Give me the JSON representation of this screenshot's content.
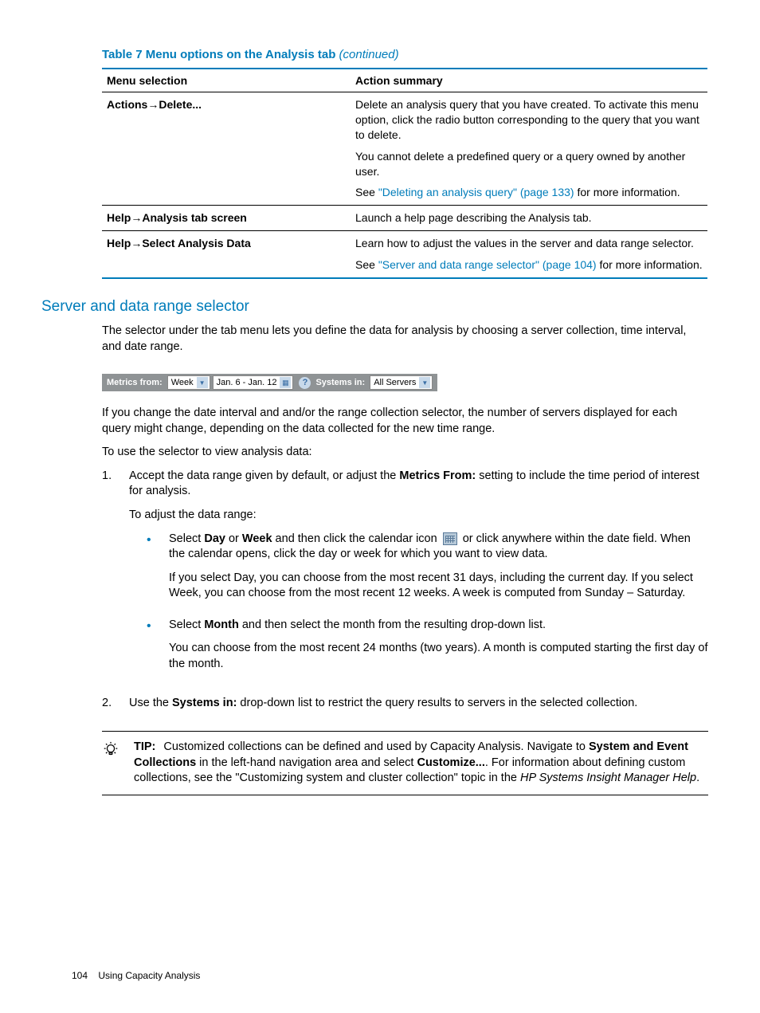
{
  "table": {
    "caption_main": "Table 7 Menu options on the Analysis tab ",
    "caption_cont": "(continued)",
    "headers": {
      "col1": "Menu selection",
      "col2": "Action summary"
    },
    "rows": [
      {
        "menu": "Actions→Delete...",
        "p1": "Delete an analysis query that you have created. To activate this menu option, click the radio button corresponding to the query that you want to delete.",
        "p2": "You cannot delete a predefined query or a query owned by another user.",
        "p3a": "See ",
        "p3link": "\"Deleting an analysis query\" (page 133)",
        "p3b": " for more information."
      },
      {
        "menu": "Help→Analysis tab screen",
        "p1": "Launch a help page describing the Analysis tab."
      },
      {
        "menu": "Help→Select Analysis Data",
        "p1": "Learn how to adjust the values in the server and data range selector.",
        "p2a": "See ",
        "p2link": "\"Server and data range selector\" (page 104)",
        "p2b": " for more information."
      }
    ]
  },
  "section_heading": "Server and data range selector",
  "intro": "The selector under the tab menu lets you define the data for analysis by choosing a server collection, time interval, and date range.",
  "toolbar": {
    "metrics_label": "Metrics from:",
    "week": "Week",
    "date": "Jan. 6 - Jan. 12",
    "help": "?",
    "systems_label": "Systems in:",
    "all": "All Servers"
  },
  "after_toolbar": "If you change the date interval and and/or the range collection selector, the number of servers displayed for each query might change, depending on the data collected for the new time range.",
  "lead": "To use the selector to view analysis data:",
  "step1": {
    "num": "1.",
    "p1a": "Accept the data range given by default, or adjust the ",
    "p1b": "Metrics From:",
    "p1c": " setting to include the time period of interest for analysis.",
    "p2": "To adjust the data range:"
  },
  "b1": {
    "p1a": "Select ",
    "p1b": "Day",
    "p1c": " or ",
    "p1d": "Week",
    "p1e": " and then click the calendar icon ",
    "p1f": " or click anywhere within the date field. When the calendar opens, click the day or week for which you want to view data.",
    "p2": "If you select Day, you can choose from the most recent 31 days, including the current day. If you select Week, you can choose from the most recent 12 weeks. A week is computed from Sunday – Saturday."
  },
  "b2": {
    "p1a": "Select ",
    "p1b": "Month",
    "p1c": " and then select the month from the resulting drop-down list.",
    "p2": "You can choose from the most recent 24 months (two years). A month is computed starting the first day of the month."
  },
  "step2": {
    "num": "2.",
    "p1a": "Use the ",
    "p1b": "Systems in:",
    "p1c": " drop-down list to restrict the query results to servers in the selected collection."
  },
  "tip": {
    "label": "TIP:",
    "t1": "Customized collections can be defined and used by Capacity Analysis. Navigate to ",
    "t2": "System and Event Collections",
    "t3": " in the left-hand navigation area and select ",
    "t4": "Customize...",
    "t5": ". For information about defining custom collections, see the \"Customizing system and cluster collection\" topic in the ",
    "t6": "HP Systems Insight Manager Help",
    "t7": "."
  },
  "footer": {
    "page": "104",
    "chapter": "Using Capacity Analysis"
  }
}
